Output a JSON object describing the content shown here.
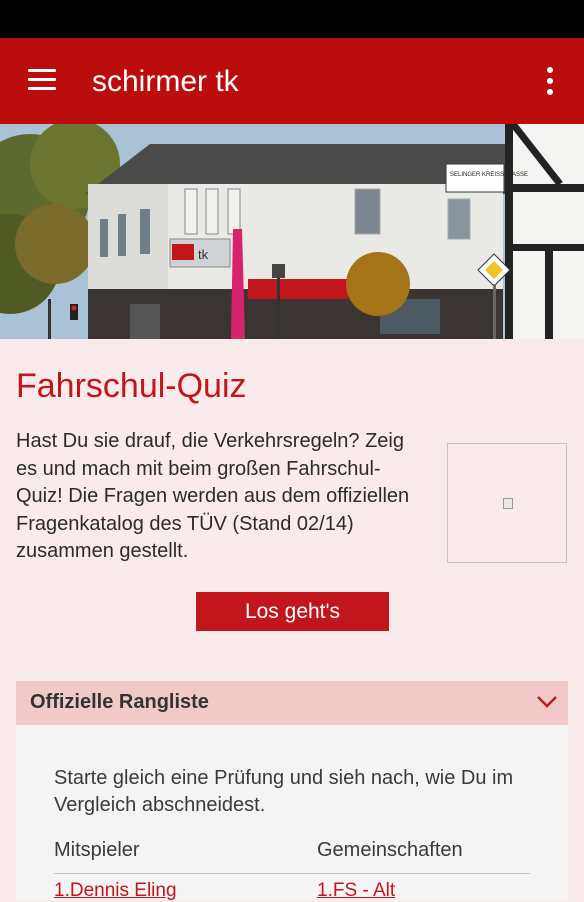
{
  "appbar": {
    "title": "schirmer tk",
    "menu_icon": "hamburger-menu-icon",
    "overflow_icon": "more-vertical-icon"
  },
  "hero": {
    "sign_text": "tk",
    "street_sign": "SELINGER KREISSTRASSE"
  },
  "quiz": {
    "title": "Fahrschul-Quiz",
    "description": "Hast Du sie drauf, die Verkehrsregeln? Zeig es und mach mit beim großen Fahrschul-Quiz! Die Fragen werden aus dem offiziellen Fragenkatalog des TÜV (Stand 02/14) zusammen gestellt.",
    "start_button": "Los geht's"
  },
  "ranking": {
    "title": "Offizielle Rangliste",
    "intro": "Starte gleich eine Prüfung und sieh nach, wie Du im Vergleich abschneidest.",
    "columns": [
      "Mitspieler",
      "Gemeinschaften"
    ],
    "rows": [
      {
        "player": "1.Dennis Eling",
        "community": "1.FS - Alt"
      }
    ]
  },
  "colors": {
    "brand_red": "#bc0d0d",
    "accent_red": "#c0161c",
    "background": "#f9ebeb",
    "accordion_header": "#f2c9c9"
  }
}
